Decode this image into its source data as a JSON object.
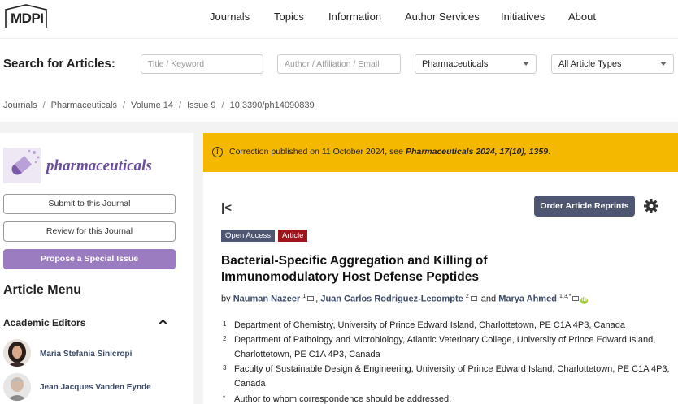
{
  "header": {
    "logo_text": "MDPI",
    "nav": [
      "Journals",
      "Topics",
      "Information",
      "Author Services",
      "Initiatives",
      "About"
    ]
  },
  "search": {
    "label": "Search for Articles:",
    "title_placeholder": "Title / Keyword",
    "author_placeholder": "Author / Affiliation / Email",
    "journal_value": "Pharmaceuticals",
    "type_value": "All Article Types"
  },
  "breadcrumb": [
    "Journals",
    "Pharmaceuticals",
    "Volume 14",
    "Issue 9",
    "10.3390/ph14090839"
  ],
  "sidebar": {
    "journal_name": "pharmaceuticals",
    "submit_label": "Submit to this Journal",
    "review_label": "Review for this Journal",
    "propose_label": "Propose a Special Issue",
    "article_menu": "Article Menu",
    "academic_editors": "Academic Editors",
    "editors": [
      "Maria Stefania Sinicropi",
      "Jean Jacques Vanden Eynde"
    ]
  },
  "correction": {
    "prefix": "Correction published on 11 October 2024, see ",
    "ref": "Pharmaceuticals 2024, 17(10), 1359",
    "suffix": "."
  },
  "article": {
    "reprint_label": "Order Article Reprints",
    "badge_oa": "Open Access",
    "badge_type": "Article",
    "title": "Bacterial-Specific Aggregation and Killing of Immunomodulatory Host Defense Peptides",
    "by": "by",
    "authors": [
      {
        "name": "Nauman Nazeer",
        "sup": "1"
      },
      {
        "name": "Juan Carlos Rodriguez-Lecompte",
        "sup": "2"
      },
      {
        "name": "Marya Ahmed",
        "sup": "1,3,*"
      }
    ],
    "and": "and",
    "affiliations": [
      {
        "num": "1",
        "text": "Department of Chemistry, University of Prince Edward Island, Charlottetown, PE C1A 4P3, Canada"
      },
      {
        "num": "2",
        "text": "Department of Pathology and Microbiology, Atlantic Veterinary College, University of Prince Edward Island, Charlottetown, PE C1A 4P3, Canada"
      },
      {
        "num": "3",
        "text": "Faculty of Sustainable Design & Engineering, University of Prince Edward Island, Charlottetown, PE C1A 4P3, Canada"
      },
      {
        "num": "*",
        "text": "Author to whom correspondence should be addressed."
      }
    ]
  },
  "colors": {
    "correction_bg": "#f5b800",
    "accent_purple": "#9b7cc0",
    "dark_button": "#4f5671",
    "article_badge": "#a0141e"
  }
}
